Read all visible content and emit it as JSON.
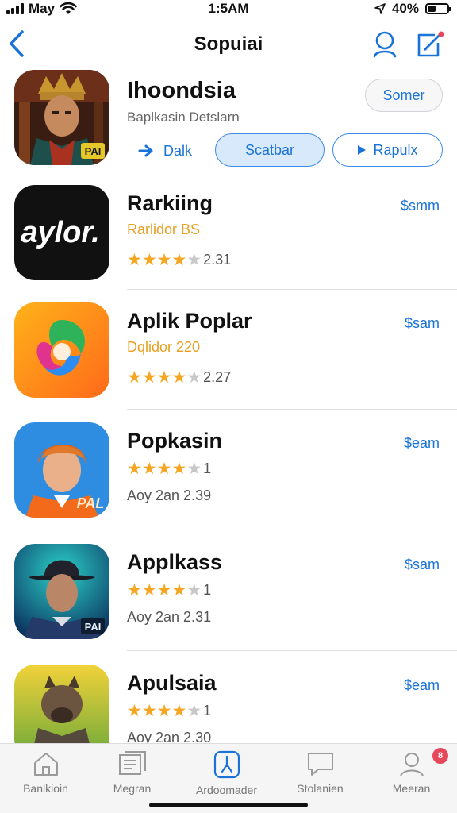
{
  "status_bar": {
    "carrier": "May",
    "time": "1:5AM",
    "battery": "40%",
    "battery_level": 0.4
  },
  "nav": {
    "title": "Sopuiai",
    "icons": [
      "chevron-left-icon",
      "search-icon",
      "compose-icon"
    ]
  },
  "featured": {
    "name": "Ihoondsia",
    "subtitle": "Baplkasin Detslarn",
    "badge": "PAI",
    "some_button": "Somer",
    "actions": {
      "dalk": "Dalk",
      "scatbar": "Scatbar",
      "rapulx": "Rapulx"
    }
  },
  "apps": [
    {
      "name": "Rarkiing",
      "price": "$smm",
      "line2": "Rarlidor BS",
      "rating": 4,
      "rating_text": "2.31",
      "icon_text": "aylor."
    },
    {
      "name": "Aplik Poplar",
      "price": "$sam",
      "line2": "Dqlidor 220",
      "rating": 4,
      "rating_text": "2.27"
    },
    {
      "name": "Popkasin",
      "price": "$eam",
      "rating": 4,
      "rating_text": "1",
      "line3": "Aoy 2an 2.39",
      "icon_badge": "PAL"
    },
    {
      "name": "Applkass",
      "price": "$sam",
      "rating": 4,
      "rating_text": "1",
      "line3": "Aoy 2an 2.31",
      "icon_badge": "PAI"
    },
    {
      "name": "Apulsaia",
      "price": "$eam",
      "rating": 4,
      "rating_text": "1",
      "line3": "Aoy 2an 2.30"
    }
  ],
  "tabs": [
    {
      "label": "Banlkioin",
      "icon": "home-icon"
    },
    {
      "label": "Megran",
      "icon": "news-icon"
    },
    {
      "label": "Ardoomader",
      "icon": "app-store-icon"
    },
    {
      "label": "Stolanien",
      "icon": "chat-icon"
    },
    {
      "label": "Meeran",
      "icon": "person-icon",
      "badge": "8"
    }
  ],
  "colors": {
    "accent": "#1a73d9",
    "star": "#f5a623",
    "orange_text": "#e8a021",
    "badge": "#e8465a"
  }
}
